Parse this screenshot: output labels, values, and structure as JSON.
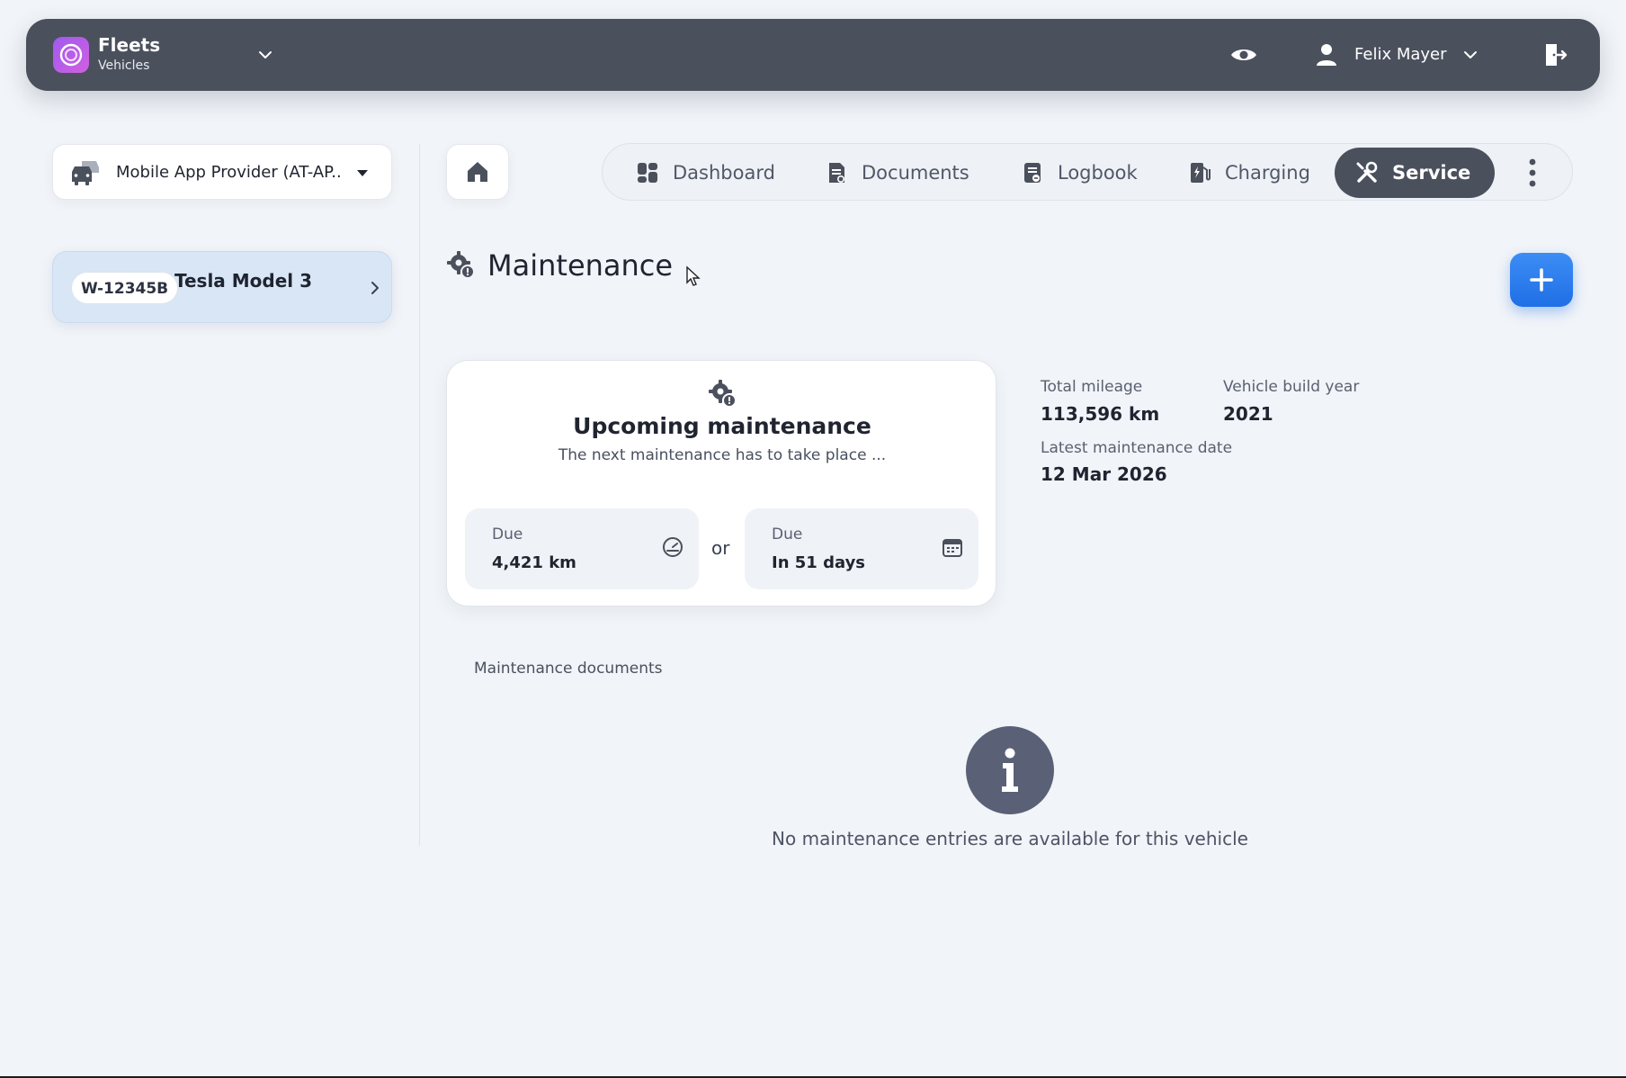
{
  "app": {
    "title": "Fleets",
    "subtitle": "Vehicles"
  },
  "header": {
    "user_name": "Felix Mayer"
  },
  "sidebar": {
    "provider_label": "Mobile App Provider (AT-AP...",
    "vehicle": {
      "plate": "W-12345B",
      "name": "Tesla Model 3"
    }
  },
  "nav": {
    "items": [
      {
        "label": "Dashboard",
        "icon": "dashboard-icon"
      },
      {
        "label": "Documents",
        "icon": "documents-icon"
      },
      {
        "label": "Logbook",
        "icon": "logbook-icon"
      },
      {
        "label": "Charging",
        "icon": "charging-icon"
      },
      {
        "label": "Service",
        "icon": "service-icon",
        "active": true
      }
    ]
  },
  "main": {
    "title": "Maintenance",
    "upcoming": {
      "title": "Upcoming maintenance",
      "subtitle": "The next maintenance has to take place ...",
      "due_km_label": "Due",
      "due_km_value": "4,421 km",
      "or_text": "or",
      "due_days_label": "Due",
      "due_days_value": "In 51 days"
    },
    "stats": {
      "mileage_label": "Total mileage",
      "mileage_value": "113,596 km",
      "build_year_label": "Vehicle build year",
      "build_year_value": "2021",
      "latest_label": "Latest maintenance date",
      "latest_value": "12 Mar 2026"
    },
    "documents_label": "Maintenance documents",
    "empty_text": "No maintenance entries are available for this vehicle"
  },
  "colors": {
    "topbar": "#4b505d",
    "accent_blue": "#1f6fe6",
    "vehicle_card": "#d8e6f6",
    "background": "#f1f4f8"
  }
}
